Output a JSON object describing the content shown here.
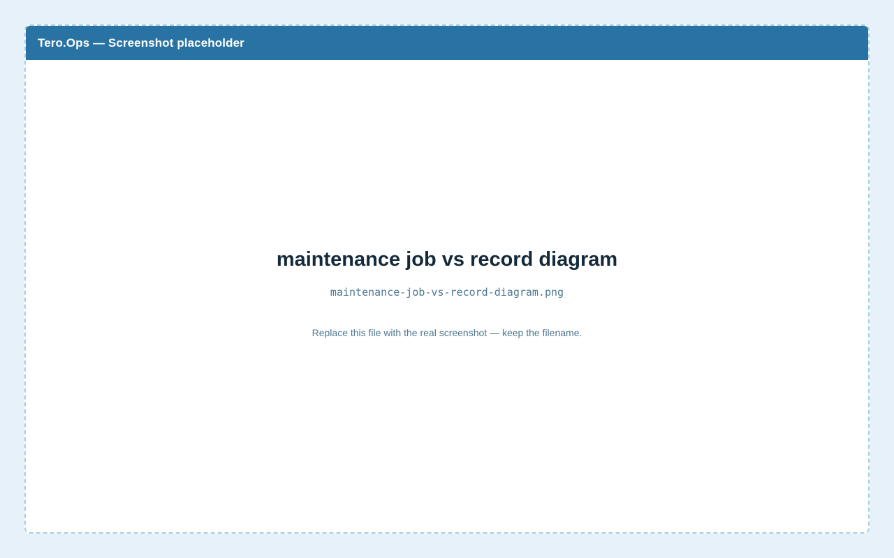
{
  "header": {
    "title": "Tero.Ops — Screenshot placeholder"
  },
  "placeholder": {
    "title": "maintenance job vs record diagram",
    "filename": "maintenance-job-vs-record-diagram.png",
    "hint": "Replace this file with the real screenshot — keep the filename."
  },
  "colors": {
    "header_bg": "#2873a3",
    "page_bg": "#e7f1f9",
    "border": "#a9cfe3",
    "title_text": "#142a3a",
    "muted_text": "#4d7891"
  }
}
